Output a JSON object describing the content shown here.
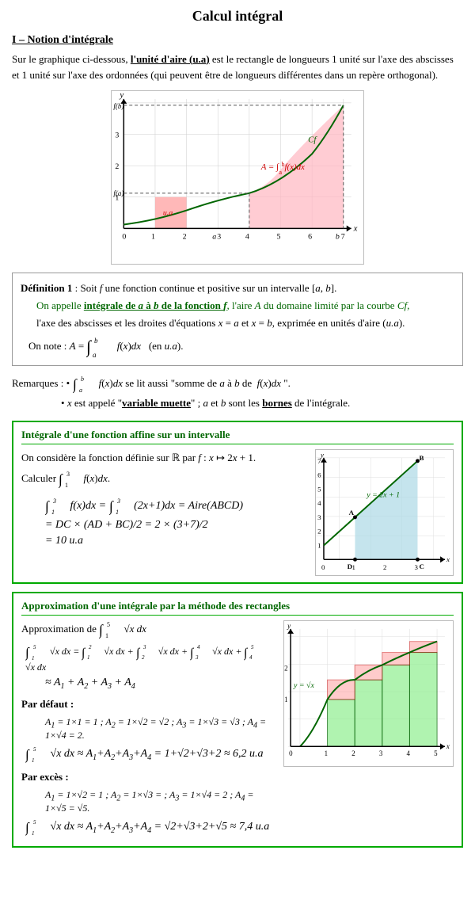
{
  "title": "Calcul intégral",
  "section1": {
    "heading": "I – Notion d'intégrale",
    "intro": "Sur le graphique ci-dessous, l'unité d'aire (u.a) est le rectangle de longueurs 1 unité sur l'axe des abscisses et 1 unité sur l'axe des ordonnées (qui peuvent être de longueurs différentes dans un repère orthogonal)."
  },
  "definition": {
    "title": "Définition 1",
    "text1": ": Soit f une fonction continue et positive sur un intervalle [a, b].",
    "text2": "On appelle intégrale de a à b de la fonction f, l'aire A du domaine limité par la courbe Cf,",
    "text3": "l'axe des abscisses et les droites d'équations x = a et x = b, exprimée en unités d'aire (u.a).",
    "text4": "On note : A = ∫ₐᵇ f(x)dx  (en u.a)."
  },
  "remarks": {
    "r1": "∫ₐᵇ f(x)dx se lit aussi \"somme de a à b de f(x)dx\".",
    "r2": "x est appelé \"variable muette\" ; a et b sont les bornes de l'intégrale."
  },
  "affine_section": {
    "title": "Intégrale d'une fonction affine sur un intervalle",
    "line1": "On considère la fonction définie sur ℝ par f : x ↦ 2x + 1.",
    "line2": "Calculer ∫₁³ f(x)dx.",
    "calc1": "∫₁³ f(x)dx = ∫₁³ (2x+1)dx = Aire(ABCD)",
    "calc2": "= DC × (AD + BC)/2 = 2 × (3+7)/2",
    "calc3": "= 10 u.a"
  },
  "approx_section": {
    "title": "Approximation d'une intégrale par la méthode des rectangles",
    "line1": "Approximation de ∫₁⁵ √x dx",
    "line2": "∫₁⁵ √x dx = ∫₁² √x dx + ∫₂³ √x dx + ∫₃⁴ √x dx + ∫₄⁵ √x dx",
    "line3": "≈ A₁ + A₂ + A₃ + A₄",
    "par_defaut": "Par défaut :",
    "defaut1": "A₁ = 1×1 = 1 ; A₂ = 1×√2 = √2 ; A₃ = 1×√3 = √3 ; A₄ = 1×√4 = 2.",
    "defaut2": "∫₁⁵ √x dx ≈ A₁+A₂+A₃+A₄ = 1+√2+√3+2 ≈ 6,2 u.a",
    "par_exces": "Par excès :",
    "exces1": "A₁ = 1×√2 = 1 ; A₂ = 1×√3 = ; A₃ = 1×√4 = 2 ; A₄ = 1×√5 = √5.",
    "exces2": "∫₁⁵ √x dx ≈ A₁+A₂+A₃+A₄ = √2+√3+2+√5 ≈ 7,4 u.a"
  }
}
